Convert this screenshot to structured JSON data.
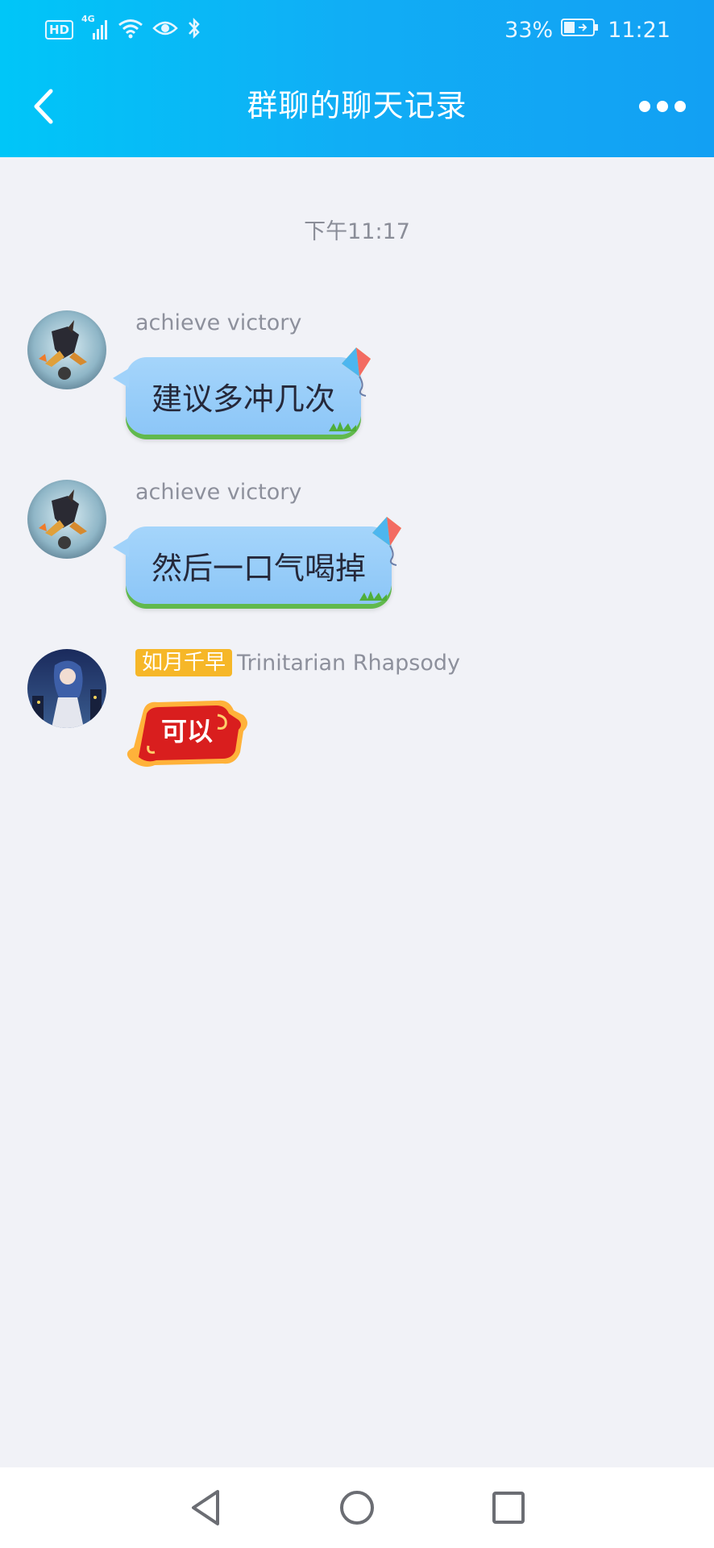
{
  "status_bar": {
    "hd_label": "HD",
    "network_label": "4G",
    "battery_percent": "33%",
    "time": "11:21"
  },
  "nav": {
    "title": "群聊的聊天记录"
  },
  "chat": {
    "timestamp": "下午11:17",
    "messages": [
      {
        "sender": "achieve victory",
        "text": "建议多冲几次"
      },
      {
        "sender": "achieve victory",
        "text": "然后一口气喝掉"
      },
      {
        "badge": "如月千早",
        "sender": "Trinitarian Rhapsody",
        "sticker_text": "可以"
      }
    ]
  },
  "colors": {
    "header_start": "#00c6f8",
    "header_end": "#12a0f3",
    "bubble": "#9dcff9",
    "badge": "#f6b728",
    "sticker": "#d91e1e"
  }
}
